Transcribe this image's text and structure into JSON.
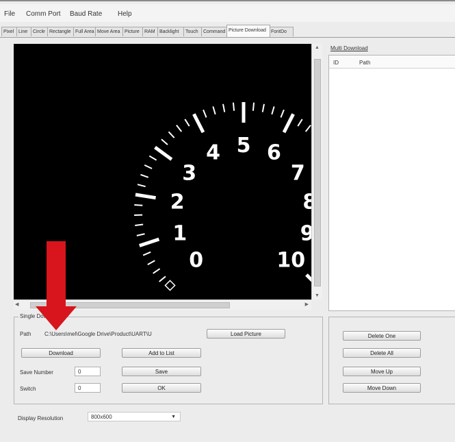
{
  "menu": [
    "File",
    "Comm Port",
    "Baud Rate",
    "Help"
  ],
  "tabs": [
    {
      "label": "Pixel"
    },
    {
      "label": "Line"
    },
    {
      "label": "Circle"
    },
    {
      "label": "Rectangle"
    },
    {
      "label": "Full Area"
    },
    {
      "label": "Move Area"
    },
    {
      "label": "Picture"
    },
    {
      "label": "RAM"
    },
    {
      "label": "Backlight"
    },
    {
      "label": "Touch"
    },
    {
      "label": "Command"
    },
    {
      "label": "Picture Download"
    },
    {
      "label": "FontDo"
    }
  ],
  "active_tab": "Picture Download",
  "gauge": {
    "numbers": [
      "0",
      "1",
      "2",
      "3",
      "4",
      "5",
      "6",
      "7",
      "8",
      "9",
      "10"
    ]
  },
  "single_download": {
    "title": "Single Download",
    "path_label": "Path",
    "path_value": "C:\\Users\\mel\\Google Drive\\Product\\UART\\U",
    "load_picture": "Load Picture",
    "download": "Download",
    "add_to_list": "Add to List",
    "save_number_label": "Save Number",
    "save_number_value": "0",
    "save": "Save",
    "switch_label": "Switch",
    "switch_value": "0",
    "ok": "OK"
  },
  "multi_download": {
    "title": "Multi Download",
    "col_id": "ID",
    "col_path": "Path",
    "delete_one": "Delete One",
    "delete_all": "Delete All",
    "move_up": "Move Up",
    "move_down": "Move Down"
  },
  "display_resolution": {
    "label": "Display Resolution",
    "value": "800x600"
  },
  "annotation_color": "#d8141c"
}
